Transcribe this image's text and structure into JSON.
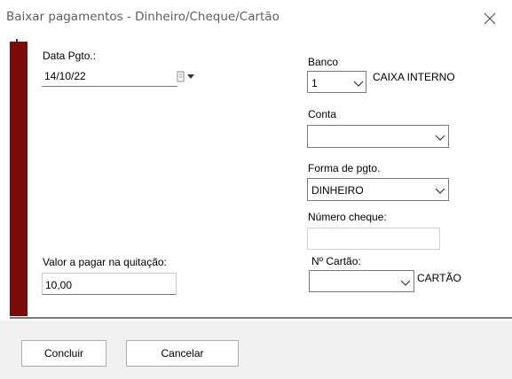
{
  "window": {
    "title": "Baixar pagamentos - Dinheiro/Cheque/Cartão",
    "close_icon": "close-icon"
  },
  "form": {
    "data_pgto": {
      "label": "Data Pgto.:",
      "value": "14/10/22",
      "icon": "calendar-dropdown-icon"
    },
    "valor": {
      "label": "Valor a pagar na quitação:",
      "value": "10,00"
    },
    "banco": {
      "label": "Banco",
      "value": "1",
      "name": "CAIXA INTERNO"
    },
    "conta": {
      "label": "Conta",
      "value": ""
    },
    "forma_pgto": {
      "label": "Forma de pgto.",
      "value": "DINHEIRO"
    },
    "numero_cheque": {
      "label": "Número cheque:",
      "value": ""
    },
    "cartao": {
      "label": "Nº Cartão:",
      "value": "",
      "name": "CARTÃO"
    }
  },
  "buttons": {
    "concluir": "Concluir",
    "cancelar": "Cancelar"
  },
  "colors": {
    "band": "#7a0b0b",
    "footer": "#f0f0f0",
    "border": "#7a7a7a"
  }
}
